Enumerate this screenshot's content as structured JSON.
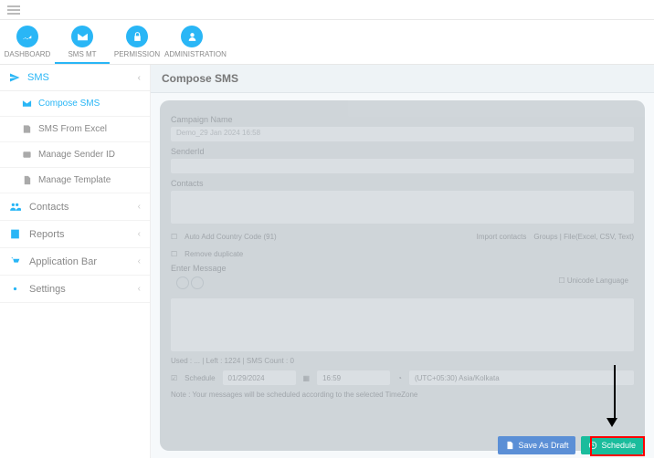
{
  "tabs": {
    "dashboard": "DASHBOARD",
    "smsmt": "SMS MT",
    "permission": "PERMISSION",
    "administration": "ADMINISTRATION"
  },
  "sidebar": {
    "sms": "SMS",
    "compose": "Compose SMS",
    "excel": "SMS From Excel",
    "sender": "Manage Sender ID",
    "template": "Manage Template",
    "contacts": "Contacts",
    "reports": "Reports",
    "appbar": "Application Bar",
    "settings": "Settings"
  },
  "page": {
    "title": "Compose SMS",
    "campaign_label": "Campaign Name",
    "campaign_value": "Demo_29 Jan 2024 16:58",
    "senderid_label": "SenderId",
    "contacts_label": "Contacts",
    "autocc": "Auto Add Country Code (91)",
    "import": "Import contacts",
    "group_links": "Groups | File(Excel, CSV, Text)",
    "remove_dup": "Remove duplicate",
    "enter_msg": "Enter Message",
    "unicode": "Unicode",
    "lang": "Language",
    "stats": "Used : ... | Left : 1224 | SMS Count : 0",
    "schedule_cb": "Schedule",
    "date": "01/29/2024",
    "time": "16:59",
    "tz": "(UTC+05:30) Asia/Kolkata",
    "note": "Note : Your messages will be scheduled according to the selected TimeZone",
    "save_draft": "Save As Draft",
    "schedule_btn": "Schedule"
  }
}
